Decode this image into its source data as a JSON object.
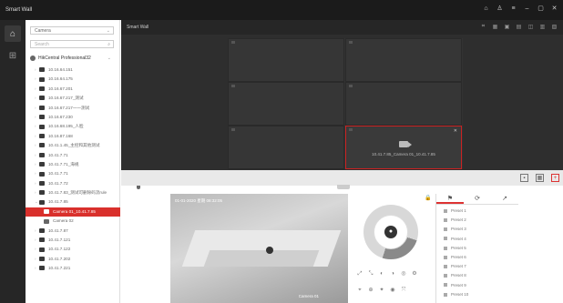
{
  "app": {
    "title": "Smart Wall"
  },
  "window_controls": [
    "bell-icon",
    "user-icon",
    "list-icon",
    "minimize-icon",
    "maximize-icon",
    "close-icon"
  ],
  "tree": {
    "dropdown": "Camera",
    "search_placeholder": "Search",
    "root": "HikCentral Professional32",
    "items": [
      {
        "label": "10.16.64.151",
        "level": 0
      },
      {
        "label": "10.16.64.175",
        "level": 0
      },
      {
        "label": "10.16.67.201",
        "level": 0
      },
      {
        "label": "10.16.67.217_测试",
        "level": 0
      },
      {
        "label": "10.16.67.217一一测试",
        "level": 0
      },
      {
        "label": "10.16.67.230",
        "level": 0
      },
      {
        "label": "10.16.68.195_人脸",
        "level": 0
      },
      {
        "label": "10.16.87.168",
        "level": 0
      },
      {
        "label": "10.41.1.45_主控和其他测试",
        "level": 0
      },
      {
        "label": "10.41.7.71",
        "level": 0
      },
      {
        "label": "10.41.7.71_海规",
        "level": 0
      },
      {
        "label": "10.41.7.71",
        "level": 0
      },
      {
        "label": "10.41.7.72",
        "level": 0
      },
      {
        "label": "10.41.7.83_测试可删除码流rule",
        "level": 0
      },
      {
        "label": "10.41.7.85",
        "level": 0,
        "expanded": true
      },
      {
        "label": "Camera 01_10.41.7.85",
        "level": 1,
        "selected": true
      },
      {
        "label": "Camera 02",
        "level": 1
      },
      {
        "label": "10.41.7.87",
        "level": 0
      },
      {
        "label": "10.41.7.121",
        "level": 0
      },
      {
        "label": "10.41.7.122",
        "level": 0
      },
      {
        "label": "10.41.7.202",
        "level": 0
      },
      {
        "label": "10.41.7.221",
        "level": 0
      }
    ]
  },
  "wall": {
    "label": "Smart Wall",
    "active_cell_label": "10.41.7.85_Camera 01_10.41.7.85"
  },
  "video": {
    "timestamp": "01-01-2020 星期 08:32:05",
    "camera_title": "Camera 01"
  },
  "preset": {
    "items": [
      "Preset 1",
      "Preset 2",
      "Preset 3",
      "Preset 4",
      "Preset 5",
      "Preset 6",
      "Preset 7",
      "Preset 8",
      "Preset 9",
      "Preset 10"
    ]
  },
  "colors": {
    "accent": "#d9302c",
    "dark_bg": "#262626"
  }
}
